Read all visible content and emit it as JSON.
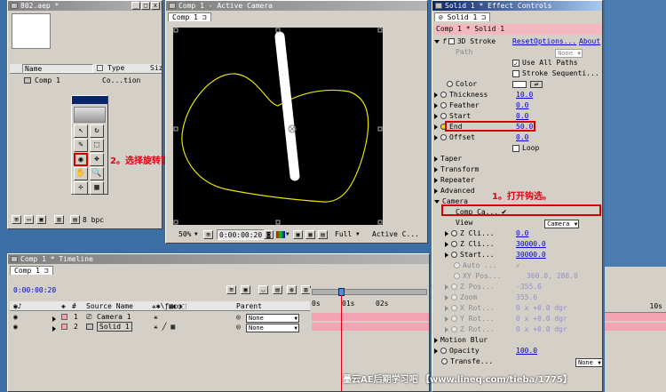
{
  "project": {
    "title": "802.aep *",
    "columns": [
      "Name",
      "Type",
      "Siz"
    ],
    "items": [
      {
        "name": "Comp 1",
        "type": "Co...tion"
      }
    ],
    "bpc": "8 bpc"
  },
  "annotations": {
    "step1": "1。打开钩选。",
    "step2": "2。选择旋转窗口。"
  },
  "comp_viewer": {
    "title": "Comp 1 - Active Camera",
    "tab": "Comp 1",
    "zoom": "50%",
    "timecode": "0:00:00:20",
    "resolution": "Full",
    "view": "Active C..."
  },
  "effect_controls": {
    "title": "Solid 1 * Effect Controls",
    "tab": "Solid 1",
    "breadcrumb": "Comp 1 * Solid 1",
    "effect_name": "3D Stroke",
    "reset": "Reset",
    "options": "Options...",
    "about": "About",
    "path_label": "Path",
    "path_value": "None",
    "use_all_paths": "Use All Paths",
    "stroke_sequentially": "Stroke Sequenti...",
    "color_label": "Color",
    "thickness_label": "Thickness",
    "thickness": "10.0",
    "feather_label": "Feather",
    "feather": "0.0",
    "start_label": "Start",
    "start": "0.0",
    "end_label": "End",
    "end": "50.0",
    "offset_label": "Offset",
    "offset": "0.0",
    "loop_label": "Loop",
    "taper": "Taper",
    "transform": "Transform",
    "repeater": "Repeater",
    "advanced": "Advanced",
    "camera": "Camera",
    "comp_camera_label": "Comp Ca...",
    "view_label": "View",
    "view_value": "Camera",
    "z_clip_front_label": "Z Cli...",
    "z_clip_front": "0.0",
    "z_clip_back_label": "Z Cli...",
    "z_clip_back": "30000.0",
    "start_fade_label": "Start...",
    "start_fade": "30000.0",
    "auto_label": "Auto ...",
    "xy_pos_label": "XY Pos...",
    "xy_pos": "360.0, 288.0",
    "z_pos_label": "Z Pos...",
    "z_pos": "-355.6",
    "zoom_label": "Zoom",
    "zoom": "355.6",
    "x_rot_label": "X Rot...",
    "x_rot": "0 x +0.0 dgr",
    "y_rot_label": "Y Rot...",
    "y_rot": "0 x +0.0 dgr",
    "z_rot_label": "Z Rot...",
    "z_rot": "0 x +0.0 dgr",
    "motion_blur": "Motion Blur",
    "opacity_label": "Opacity",
    "opacity": "100.0",
    "transfer_label": "Transfe...",
    "transfer_value": "None"
  },
  "timeline": {
    "title": "Comp 1 * Timeline",
    "tab": "Comp 1",
    "timecode": "0:00:00:20",
    "col_number": "#",
    "col_source": "Source Name",
    "col_parent": "Parent",
    "ruler": [
      "0s",
      "01s",
      "02s",
      "10s"
    ],
    "layers": [
      {
        "num": "1",
        "name": "Camera 1",
        "parent": "None"
      },
      {
        "num": "2",
        "name": "Solid 1",
        "parent": "None"
      }
    ]
  },
  "watermark": "墨云AE后期学习吧 【www.lineq.com/tieba/1775】",
  "colors": {
    "accent_red": "#d40000",
    "title_active": "#0a246a",
    "stroke_yellow": "#e6e600",
    "bar_pink": "#f4a3b4"
  }
}
